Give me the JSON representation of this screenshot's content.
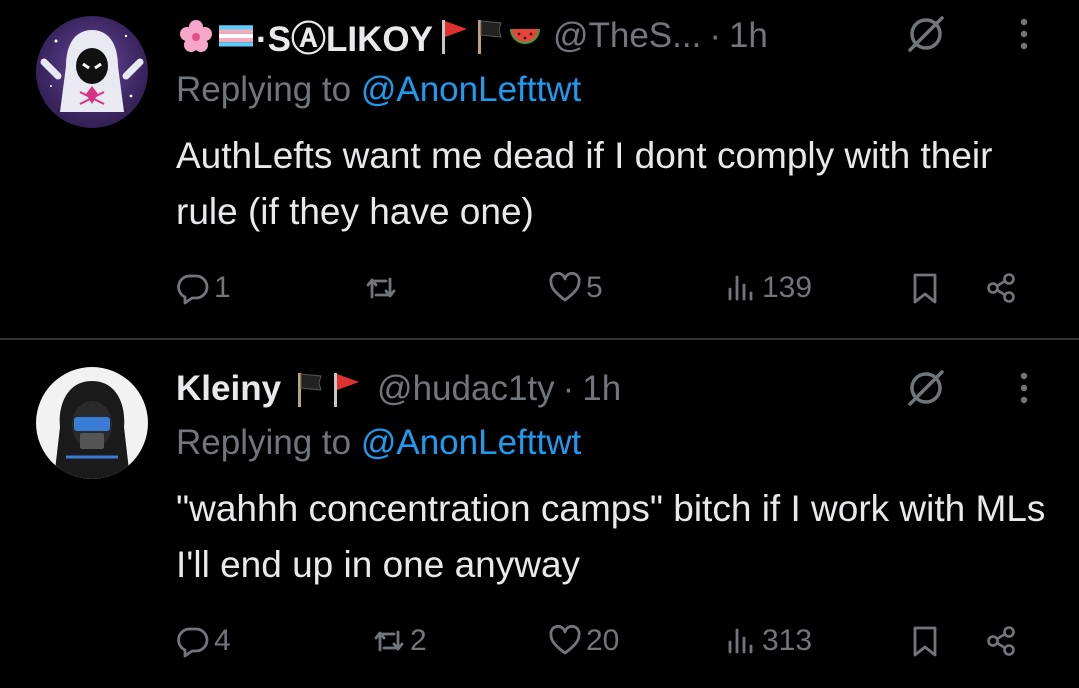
{
  "tweets": [
    {
      "display_name": "·SⒶLIKOY",
      "handle": "@TheS...",
      "separator": "·",
      "time": "1h",
      "reply_prefix": "Replying to ",
      "reply_to": "@AnonLefttwt",
      "text": "AuthLefts want me dead if I dont comply with their rule (if they have one)",
      "replies": "1",
      "retweets": "",
      "likes": "5",
      "views": "139",
      "badges": [
        "cherry-blossom-emoji",
        "trans-flag-emoji",
        "red-flag-icon",
        "black-flag-icon",
        "watermelon-emoji"
      ]
    },
    {
      "display_name": "Kleiny",
      "handle": "@hudac1ty",
      "separator": "·",
      "time": "1h",
      "reply_prefix": "Replying to ",
      "reply_to": "@AnonLefttwt",
      "text": "\"wahhh concentration camps\" bitch if I work with MLs I'll end up in one anyway",
      "replies": "4",
      "retweets": "2",
      "likes": "20",
      "views": "313",
      "badges": [
        "black-flag-icon",
        "red-flag-icon"
      ]
    }
  ],
  "colors": {
    "background": "#000000",
    "text": "#e7e9ea",
    "muted": "#71767b",
    "link": "#1d9bf0",
    "divider": "#2f3336"
  }
}
